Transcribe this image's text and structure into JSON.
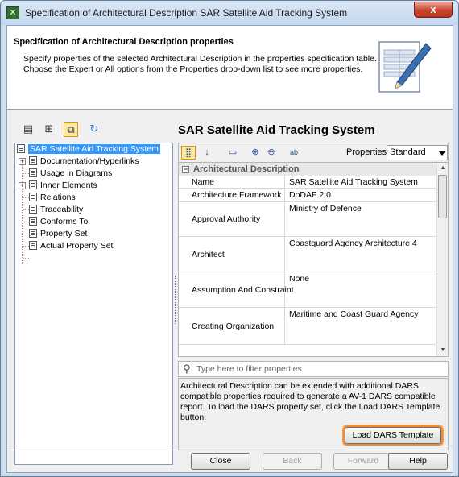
{
  "window": {
    "title": "Specification of Architectural Description SAR Satellite Aid Tracking System",
    "close_glyph": "x"
  },
  "header": {
    "title": "Specification of Architectural Description properties",
    "description": "Specify properties of the selected Architectural Description in the properties specification table. Choose the Expert or All options from the Properties drop-down list to see more properties."
  },
  "tree_toolbar": {
    "icons": [
      "list-view-icon",
      "hierarchy-icon",
      "copy-icon",
      "refresh-icon"
    ]
  },
  "tree": {
    "items": [
      {
        "label": "SAR Satellite Aid Tracking System",
        "selected": true
      },
      {
        "label": "Documentation/Hyperlinks",
        "expandable": true
      },
      {
        "label": "Usage in Diagrams"
      },
      {
        "label": "Inner Elements",
        "expandable": true
      },
      {
        "label": "Relations"
      },
      {
        "label": "Traceability"
      },
      {
        "label": "Conforms To"
      },
      {
        "label": "Property Set"
      },
      {
        "label": "Actual Property Set"
      }
    ]
  },
  "spec": {
    "title": "SAR Satellite Aid Tracking System",
    "properties_label": "Properties:",
    "properties_value": "Standard",
    "section": "Architectural Description",
    "section_glyph": "−",
    "rows": [
      {
        "name": "Name",
        "value": "SAR Satellite Aid Tracking System"
      },
      {
        "name": "Architecture Framework",
        "value": "DoDAF 2.0"
      },
      {
        "name": "Approval Authority",
        "value": "Ministry of Defence"
      },
      {
        "name": "Architect",
        "value": "Coastguard Agency Architecture 4"
      },
      {
        "name": "Assumption And Constraint",
        "value": "None"
      },
      {
        "name": "Creating Organization",
        "value": "Maritime and Coast Guard Agency"
      }
    ],
    "filter_placeholder": "Type here to filter properties",
    "info_text": "Architectural Description can be extended with additional DARS compatible properties required to generate a AV-1 DARS compatible report. To load the DARS property set, click the Load DARS Template button.",
    "load_button": "Load DARS Template"
  },
  "buttons": {
    "close": "Close",
    "back": "Back",
    "forward": "Forward",
    "help": "Help"
  }
}
